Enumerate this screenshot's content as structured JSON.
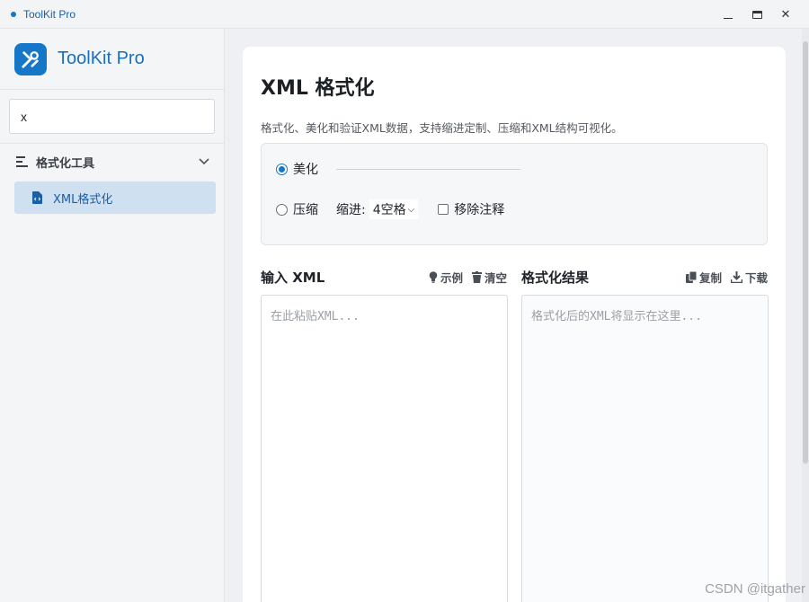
{
  "window": {
    "title": "ToolKit Pro"
  },
  "sidebar": {
    "brand": "ToolKit Pro",
    "search_value": "x",
    "group_label": "格式化工具",
    "items": [
      {
        "label": "XML格式化"
      }
    ]
  },
  "main": {
    "title": "XML 格式化",
    "description": "格式化、美化和验证XML数据，支持缩进定制、压缩和XML结构可视化。",
    "options": {
      "mode_beautify": "美化",
      "mode_compress": "压缩",
      "indent_label": "缩进:",
      "indent_value": "4空格",
      "remove_comments": "移除注释"
    },
    "input_panel": {
      "title": "输入 XML",
      "example_label": "示例",
      "clear_label": "清空",
      "placeholder": "在此粘贴XML..."
    },
    "output_panel": {
      "title": "格式化结果",
      "copy_label": "复制",
      "download_label": "下载",
      "placeholder": "格式化后的XML将显示在这里..."
    }
  },
  "watermark": "CSDN @itgather",
  "colors": {
    "accent": "#1677c8",
    "nav_active_bg": "#cfe0f0"
  }
}
